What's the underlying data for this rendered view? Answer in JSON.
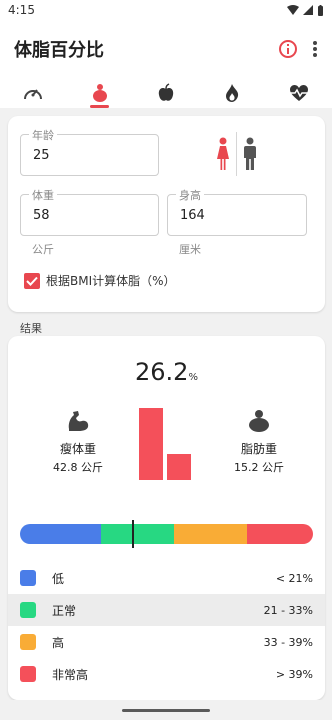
{
  "status_bar": {
    "time": "4:15"
  },
  "app_bar": {
    "title": "体脂百分比"
  },
  "tabs": [
    {
      "icon": "speedometer-icon"
    },
    {
      "icon": "body-fat-icon",
      "active": true
    },
    {
      "icon": "apple-icon"
    },
    {
      "icon": "flame-icon"
    },
    {
      "icon": "heart-pulse-icon"
    }
  ],
  "inputs": {
    "age": {
      "label": "年龄",
      "value": "25"
    },
    "weight": {
      "label": "体重",
      "value": "58",
      "unit": "公斤"
    },
    "height": {
      "label": "身高",
      "value": "164",
      "unit": "厘米"
    },
    "bmi_checkbox": {
      "label": "根据BMI计算体脂（%）",
      "checked": true
    },
    "gender_selected": "female"
  },
  "results": {
    "section_label": "结果",
    "body_fat_value": "26.2",
    "body_fat_unit": "%",
    "lean_mass": {
      "label": "瘦体重",
      "value": "42.8 公斤"
    },
    "fat_mass": {
      "label": "脂肪重",
      "value": "15.2 公斤"
    },
    "bar_chart": {
      "lean_kg": 42.8,
      "fat_kg": 15.2
    },
    "scale_marker_value": 26.2,
    "categories": [
      {
        "label": "低",
        "range": "< 21%",
        "color": "#4a7de8"
      },
      {
        "label": "正常",
        "range": "21 - 33%",
        "color": "#27d882",
        "highlighted": true
      },
      {
        "label": "高",
        "range": "33 - 39%",
        "color": "#f9ac36"
      },
      {
        "label": "非常高",
        "range": "> 39%",
        "color": "#f4505a"
      }
    ]
  },
  "colors": {
    "accent": "#e8474f",
    "male": "#555555"
  }
}
